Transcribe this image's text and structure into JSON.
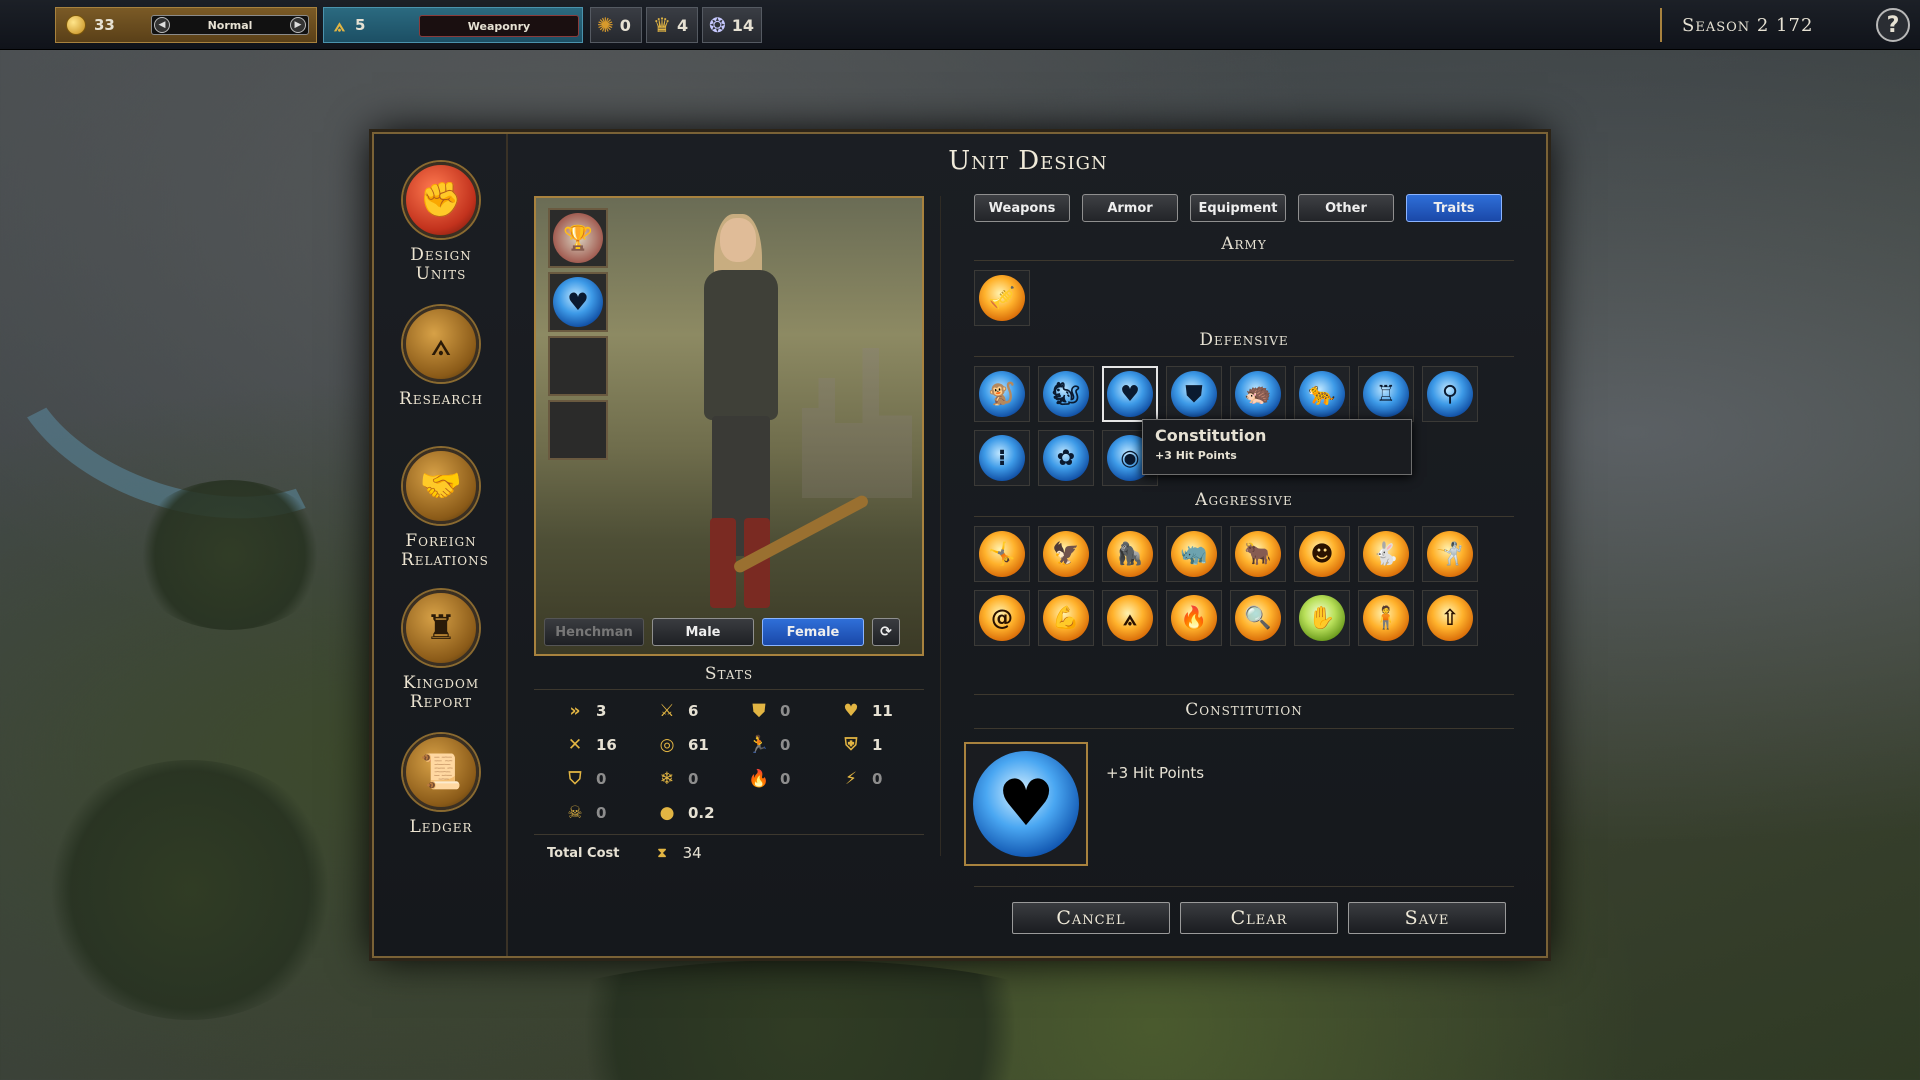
{
  "topbar": {
    "gold": "33",
    "difficulty": "Normal",
    "research_points": "5",
    "research_field": "Weaponry",
    "resource_a": "0",
    "resource_b": "4",
    "resource_c": "14",
    "season": "Season 2 172",
    "help": "?"
  },
  "nav": {
    "design_units": "Design Units",
    "research": "Research",
    "foreign_relations": "Foreign Relations",
    "kingdom_report": "Kingdom Report",
    "ledger": "Ledger"
  },
  "dialog": {
    "title": "Unit Design"
  },
  "portrait": {
    "buttons": {
      "henchman": "Henchman",
      "male": "Male",
      "female": "Female"
    }
  },
  "stats": {
    "title": "Stats",
    "rows": [
      [
        "3",
        "6",
        "0",
        "11"
      ],
      [
        "16",
        "61",
        "0",
        "1"
      ],
      [
        "0",
        "0",
        "0",
        "0"
      ],
      [
        "0",
        "0.2"
      ]
    ],
    "total_cost_label": "Total Cost",
    "total_cost": "34"
  },
  "tabs": [
    "Weapons",
    "Armor",
    "Equipment",
    "Other",
    "Traits"
  ],
  "sections": {
    "army": "Army",
    "defensive": "Defensive",
    "aggressive": "Aggressive"
  },
  "tooltip": {
    "title": "Constitution",
    "desc": "+3 Hit Points"
  },
  "detail": {
    "title": "Constitution",
    "desc": "+3 Hit Points"
  },
  "actions": {
    "cancel": "Cancel",
    "clear": "Clear",
    "save": "Save"
  },
  "colors": {
    "accent_gold": "#a8823e",
    "selected_blue": "#2f6fd8"
  }
}
